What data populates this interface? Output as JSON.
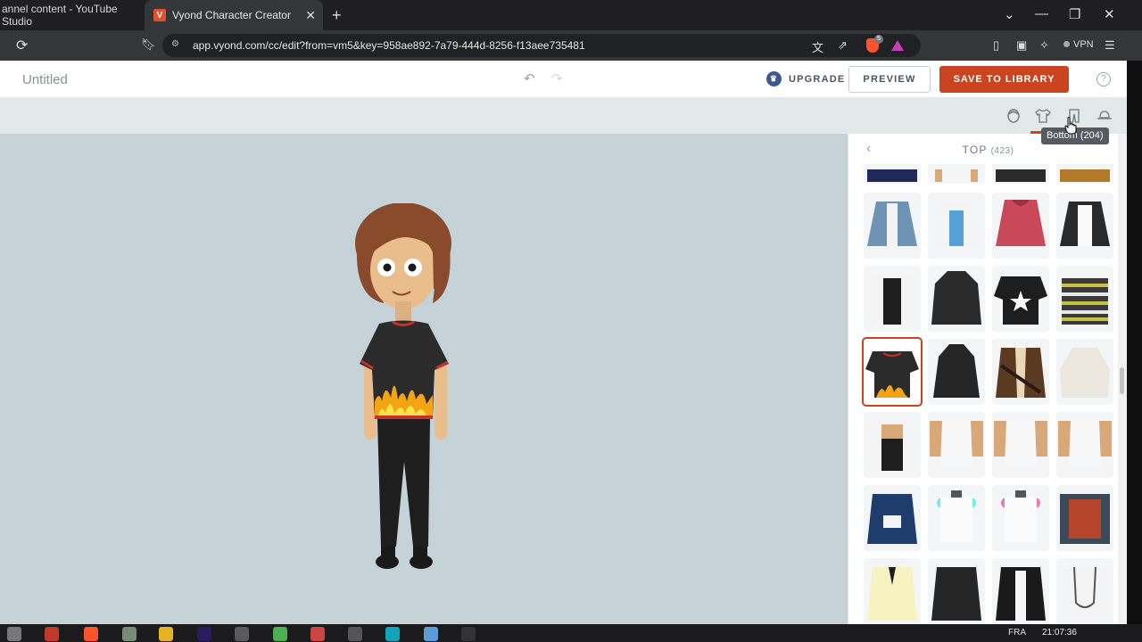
{
  "browser": {
    "tabs": [
      {
        "title": "annel content - YouTube Studio",
        "active": false
      },
      {
        "title": "Vyond Character Creator",
        "active": true,
        "favicon": "V"
      }
    ],
    "url": "app.vyond.com/cc/edit?from=vm5&key=958ae892-7a79-444d-8256-f13aee735481",
    "vpn_label": "VPN",
    "brave_badge": "5"
  },
  "app": {
    "doc_title": "Untitled",
    "upgrade_label": "UPGRADE",
    "preview_label": "PREVIEW",
    "save_label": "SAVE TO LIBRARY",
    "help_label": "?"
  },
  "toolbar": {
    "categories": [
      "head-icon",
      "top-shirt-icon",
      "bottom-pants-icon",
      "hat-icon"
    ],
    "active_category": "top",
    "tooltip": "Bottom (204)"
  },
  "panel": {
    "title": "TOP",
    "count": "(423)",
    "selected_index": 12,
    "item_count": 28
  },
  "taskbar": {
    "clock": "21:07:36",
    "lang": "FRA"
  },
  "colors": {
    "accent": "#c9441f",
    "stage": "#c5d3d9",
    "crown": "#3d5a8a"
  }
}
